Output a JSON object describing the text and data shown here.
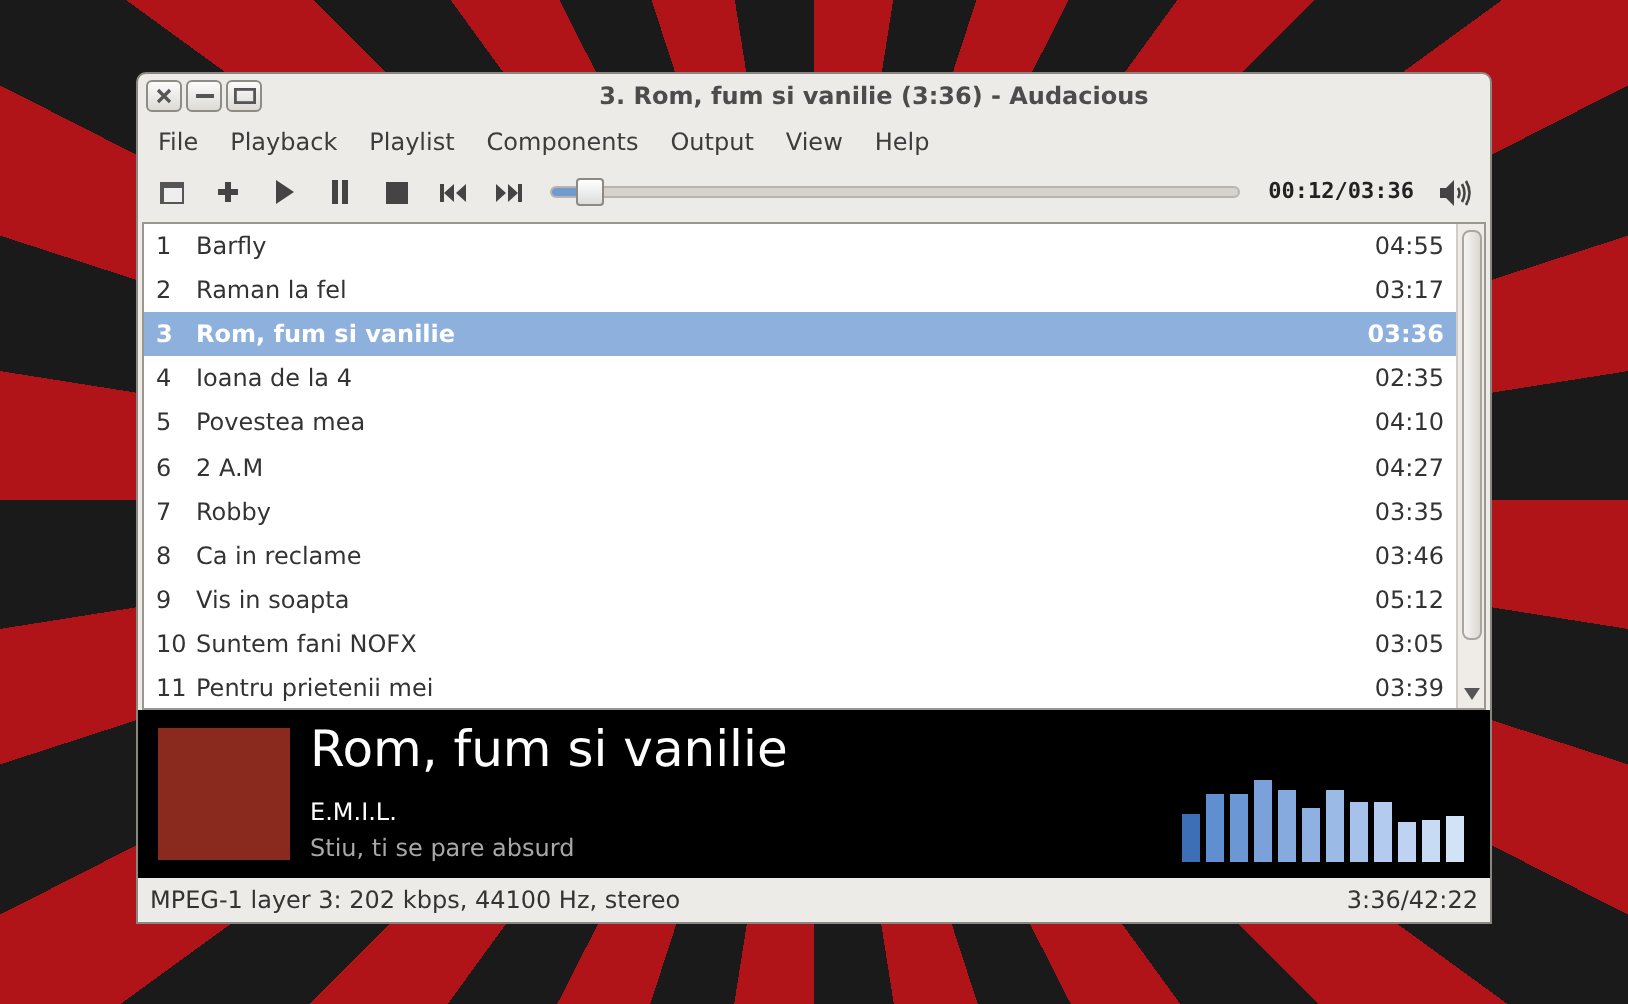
{
  "window": {
    "title": "3. Rom, fum si vanilie (3:36) - Audacious"
  },
  "menu": [
    "File",
    "Playback",
    "Playlist",
    "Components",
    "Output",
    "View",
    "Help"
  ],
  "toolbar": {
    "seek": {
      "level": 0.056
    },
    "time": "00:12/03:36"
  },
  "playlist": [
    {
      "number": "1",
      "title": "Barfly",
      "length": "04:55",
      "selected": false
    },
    {
      "number": "2",
      "title": "Raman la fel",
      "length": "03:17",
      "selected": false
    },
    {
      "number": "3",
      "title": "Rom, fum si vanilie",
      "length": "03:36",
      "selected": true
    },
    {
      "number": "4",
      "title": "Ioana de la 4",
      "length": "02:35",
      "selected": false
    },
    {
      "number": "5",
      "title": "Povestea mea",
      "length": "04:10",
      "selected": false
    },
    {
      "number": "6",
      "title": "2 A.M",
      "length": "04:27",
      "selected": false
    },
    {
      "number": "7",
      "title": "Robby",
      "length": "03:35",
      "selected": false
    },
    {
      "number": "8",
      "title": "Ca in reclame",
      "length": "03:46",
      "selected": false
    },
    {
      "number": "9",
      "title": "Vis in soapta",
      "length": "05:12",
      "selected": false
    },
    {
      "number": "10",
      "title": "Suntem fani NOFX",
      "length": "03:05",
      "selected": false
    },
    {
      "number": "11",
      "title": "Pentru prietenii mei",
      "length": "03:39",
      "selected": false
    }
  ],
  "now_playing": {
    "title": "Rom, fum si vanilie",
    "artist": "E.M.I.L.",
    "album": "Stiu, ti se pare absurd"
  },
  "status_bar": {
    "format": "MPEG-1 layer 3: 202 kbps, 44100 Hz, stereo",
    "total": "3:36/42:22"
  }
}
